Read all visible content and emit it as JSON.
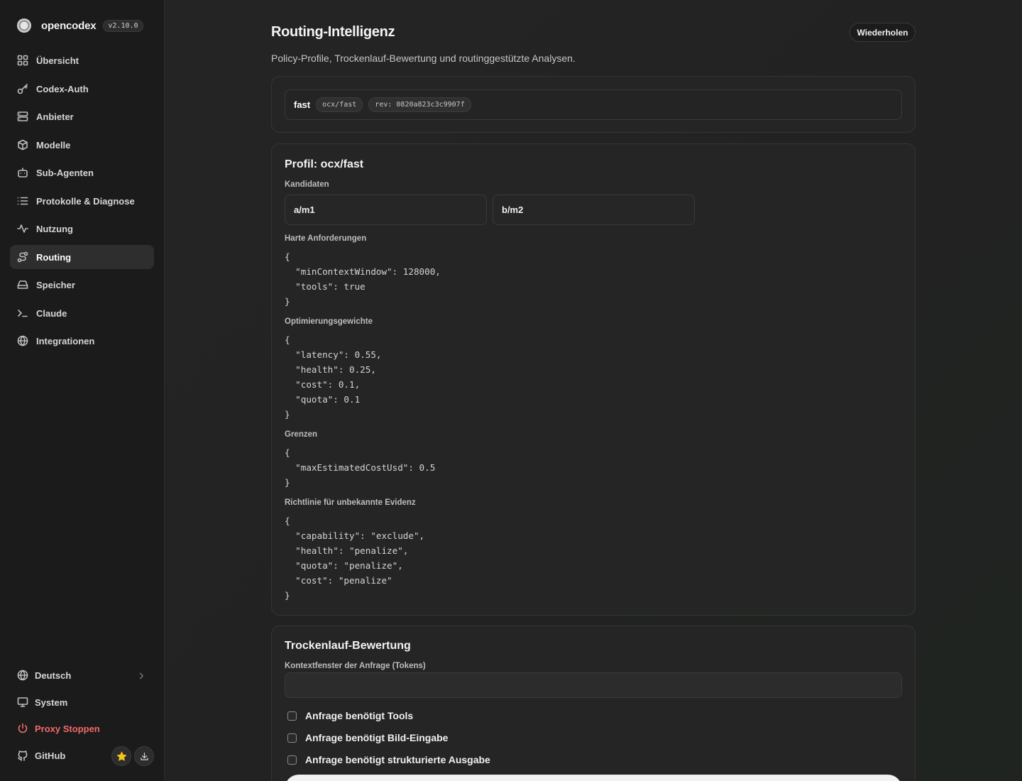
{
  "brand": {
    "name": "opencodex",
    "version": "v2.10.0"
  },
  "nav": [
    {
      "id": "overview",
      "label": "Übersicht",
      "icon": "grid-icon"
    },
    {
      "id": "codex-auth",
      "label": "Codex-Auth",
      "icon": "key-icon"
    },
    {
      "id": "providers",
      "label": "Anbieter",
      "icon": "server-icon"
    },
    {
      "id": "models",
      "label": "Modelle",
      "icon": "cube-icon"
    },
    {
      "id": "sub-agents",
      "label": "Sub-Agenten",
      "icon": "bot-icon"
    },
    {
      "id": "logs",
      "label": "Protokolle & Diagnose",
      "icon": "list-icon"
    },
    {
      "id": "usage",
      "label": "Nutzung",
      "icon": "activity-icon"
    },
    {
      "id": "routing",
      "label": "Routing",
      "icon": "route-icon",
      "active": true
    },
    {
      "id": "storage",
      "label": "Speicher",
      "icon": "hard-drive-icon"
    },
    {
      "id": "claude",
      "label": "Claude",
      "icon": "terminal-icon"
    },
    {
      "id": "integrations",
      "label": "Integrationen",
      "icon": "globe-icon"
    }
  ],
  "footer": {
    "language": "Deutsch",
    "system": "System",
    "stop_proxy": "Proxy Stoppen",
    "github": "GitHub"
  },
  "colors": {
    "accent_stop": "#f26a6a",
    "star": "#f5c518"
  },
  "page": {
    "title": "Routing-Intelligenz",
    "subtitle": "Policy-Profile, Trockenlauf-Bewertung und routinggestützte Analysen.",
    "retry_label": "Wiederholen"
  },
  "profile_tab": {
    "name": "fast",
    "id": "ocx/fast",
    "rev": "rev: 0820a823c3c9907f"
  },
  "profile": {
    "title": "Profil: ocx/fast",
    "candidates_label": "Kandidaten",
    "candidates": [
      "a/m1",
      "b/m2"
    ],
    "hard_label": "Harte Anforderungen",
    "hard_json": "{\n  \"minContextWindow\": 128000,\n  \"tools\": true\n}",
    "weights_label": "Optimierungsgewichte",
    "weights_json": "{\n  \"latency\": 0.55,\n  \"health\": 0.25,\n  \"cost\": 0.1,\n  \"quota\": 0.1\n}",
    "limits_label": "Grenzen",
    "limits_json": "{\n  \"maxEstimatedCostUsd\": 0.5\n}",
    "unknown_label": "Richtlinie für unbekannte Evidenz",
    "unknown_json": "{\n  \"capability\": \"exclude\",\n  \"health\": \"penalize\",\n  \"quota\": \"penalize\",\n  \"cost\": \"penalize\"\n}"
  },
  "dryrun": {
    "title": "Trockenlauf-Bewertung",
    "context_label": "Kontextfenster der Anfrage (Tokens)",
    "context_value": "",
    "checks": [
      {
        "label": "Anfrage benötigt Tools",
        "checked": false
      },
      {
        "label": "Anfrage benötigt Bild-Eingabe",
        "checked": false
      },
      {
        "label": "Anfrage benötigt strukturierte Ausgabe",
        "checked": false
      }
    ]
  }
}
